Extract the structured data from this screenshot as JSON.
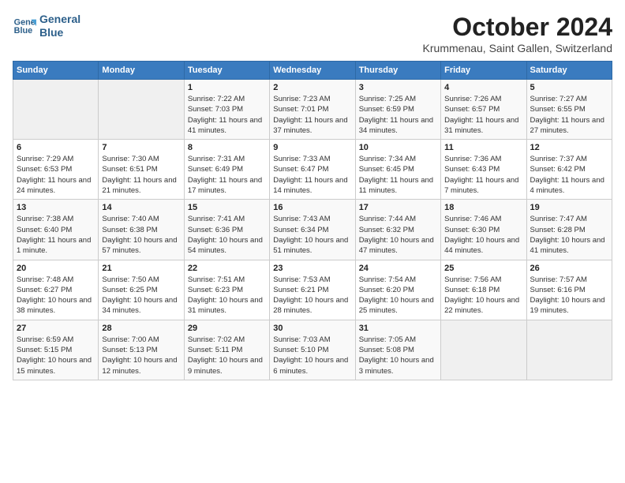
{
  "header": {
    "logo_line1": "General",
    "logo_line2": "Blue",
    "month": "October 2024",
    "location": "Krummenau, Saint Gallen, Switzerland"
  },
  "weekdays": [
    "Sunday",
    "Monday",
    "Tuesday",
    "Wednesday",
    "Thursday",
    "Friday",
    "Saturday"
  ],
  "weeks": [
    [
      {
        "day": "",
        "info": ""
      },
      {
        "day": "",
        "info": ""
      },
      {
        "day": "1",
        "info": "Sunrise: 7:22 AM\nSunset: 7:03 PM\nDaylight: 11 hours and 41 minutes."
      },
      {
        "day": "2",
        "info": "Sunrise: 7:23 AM\nSunset: 7:01 PM\nDaylight: 11 hours and 37 minutes."
      },
      {
        "day": "3",
        "info": "Sunrise: 7:25 AM\nSunset: 6:59 PM\nDaylight: 11 hours and 34 minutes."
      },
      {
        "day": "4",
        "info": "Sunrise: 7:26 AM\nSunset: 6:57 PM\nDaylight: 11 hours and 31 minutes."
      },
      {
        "day": "5",
        "info": "Sunrise: 7:27 AM\nSunset: 6:55 PM\nDaylight: 11 hours and 27 minutes."
      }
    ],
    [
      {
        "day": "6",
        "info": "Sunrise: 7:29 AM\nSunset: 6:53 PM\nDaylight: 11 hours and 24 minutes."
      },
      {
        "day": "7",
        "info": "Sunrise: 7:30 AM\nSunset: 6:51 PM\nDaylight: 11 hours and 21 minutes."
      },
      {
        "day": "8",
        "info": "Sunrise: 7:31 AM\nSunset: 6:49 PM\nDaylight: 11 hours and 17 minutes."
      },
      {
        "day": "9",
        "info": "Sunrise: 7:33 AM\nSunset: 6:47 PM\nDaylight: 11 hours and 14 minutes."
      },
      {
        "day": "10",
        "info": "Sunrise: 7:34 AM\nSunset: 6:45 PM\nDaylight: 11 hours and 11 minutes."
      },
      {
        "day": "11",
        "info": "Sunrise: 7:36 AM\nSunset: 6:43 PM\nDaylight: 11 hours and 7 minutes."
      },
      {
        "day": "12",
        "info": "Sunrise: 7:37 AM\nSunset: 6:42 PM\nDaylight: 11 hours and 4 minutes."
      }
    ],
    [
      {
        "day": "13",
        "info": "Sunrise: 7:38 AM\nSunset: 6:40 PM\nDaylight: 11 hours and 1 minute."
      },
      {
        "day": "14",
        "info": "Sunrise: 7:40 AM\nSunset: 6:38 PM\nDaylight: 10 hours and 57 minutes."
      },
      {
        "day": "15",
        "info": "Sunrise: 7:41 AM\nSunset: 6:36 PM\nDaylight: 10 hours and 54 minutes."
      },
      {
        "day": "16",
        "info": "Sunrise: 7:43 AM\nSunset: 6:34 PM\nDaylight: 10 hours and 51 minutes."
      },
      {
        "day": "17",
        "info": "Sunrise: 7:44 AM\nSunset: 6:32 PM\nDaylight: 10 hours and 47 minutes."
      },
      {
        "day": "18",
        "info": "Sunrise: 7:46 AM\nSunset: 6:30 PM\nDaylight: 10 hours and 44 minutes."
      },
      {
        "day": "19",
        "info": "Sunrise: 7:47 AM\nSunset: 6:28 PM\nDaylight: 10 hours and 41 minutes."
      }
    ],
    [
      {
        "day": "20",
        "info": "Sunrise: 7:48 AM\nSunset: 6:27 PM\nDaylight: 10 hours and 38 minutes."
      },
      {
        "day": "21",
        "info": "Sunrise: 7:50 AM\nSunset: 6:25 PM\nDaylight: 10 hours and 34 minutes."
      },
      {
        "day": "22",
        "info": "Sunrise: 7:51 AM\nSunset: 6:23 PM\nDaylight: 10 hours and 31 minutes."
      },
      {
        "day": "23",
        "info": "Sunrise: 7:53 AM\nSunset: 6:21 PM\nDaylight: 10 hours and 28 minutes."
      },
      {
        "day": "24",
        "info": "Sunrise: 7:54 AM\nSunset: 6:20 PM\nDaylight: 10 hours and 25 minutes."
      },
      {
        "day": "25",
        "info": "Sunrise: 7:56 AM\nSunset: 6:18 PM\nDaylight: 10 hours and 22 minutes."
      },
      {
        "day": "26",
        "info": "Sunrise: 7:57 AM\nSunset: 6:16 PM\nDaylight: 10 hours and 19 minutes."
      }
    ],
    [
      {
        "day": "27",
        "info": "Sunrise: 6:59 AM\nSunset: 5:15 PM\nDaylight: 10 hours and 15 minutes."
      },
      {
        "day": "28",
        "info": "Sunrise: 7:00 AM\nSunset: 5:13 PM\nDaylight: 10 hours and 12 minutes."
      },
      {
        "day": "29",
        "info": "Sunrise: 7:02 AM\nSunset: 5:11 PM\nDaylight: 10 hours and 9 minutes."
      },
      {
        "day": "30",
        "info": "Sunrise: 7:03 AM\nSunset: 5:10 PM\nDaylight: 10 hours and 6 minutes."
      },
      {
        "day": "31",
        "info": "Sunrise: 7:05 AM\nSunset: 5:08 PM\nDaylight: 10 hours and 3 minutes."
      },
      {
        "day": "",
        "info": ""
      },
      {
        "day": "",
        "info": ""
      }
    ]
  ]
}
